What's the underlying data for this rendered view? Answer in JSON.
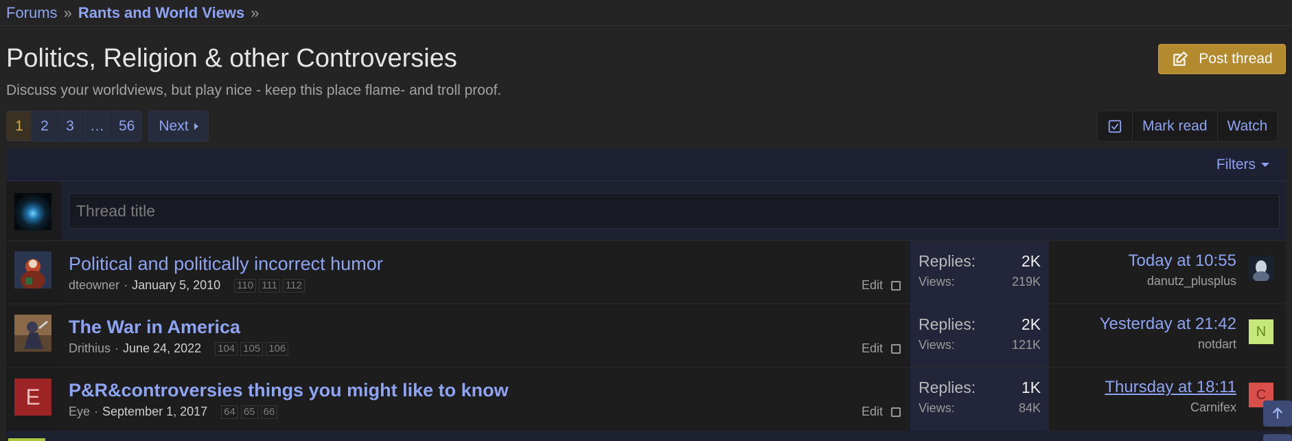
{
  "breadcrumb": {
    "items": [
      "Forums",
      "Rants and World Views"
    ]
  },
  "page": {
    "title": "Politics, Religion & other Controversies",
    "description": "Discuss your worldviews, but play nice - keep this place flame- and troll proof.",
    "post_thread_label": "Post thread"
  },
  "pagination": {
    "pages": [
      "1",
      "2",
      "3",
      "…",
      "56"
    ],
    "next_label": "Next"
  },
  "actions": {
    "mark_read_label": "Mark read",
    "watch_label": "Watch"
  },
  "filters": {
    "label": "Filters"
  },
  "quick_thread": {
    "placeholder": "Thread title"
  },
  "threads": [
    {
      "title": "Political and politically incorrect humor",
      "author": "dteowner",
      "date": "January 5, 2010",
      "pages": [
        "110",
        "111",
        "112"
      ],
      "edit_label": "Edit",
      "replies_label": "Replies:",
      "replies": "2K",
      "views_label": "Views:",
      "views": "219K",
      "last_date": "Today at 10:55",
      "last_user": "danutz_plusplus"
    },
    {
      "title": "The War in America",
      "author": "Drithius",
      "date": "June 24, 2022",
      "pages": [
        "104",
        "105",
        "106"
      ],
      "edit_label": "Edit",
      "replies_label": "Replies:",
      "replies": "2K",
      "views_label": "Views:",
      "views": "121K",
      "last_date": "Yesterday at 21:42",
      "last_user": "notdart",
      "last_avatar_letter": "N"
    },
    {
      "title": "P&R&controversies things you might like to know",
      "author": "Eye",
      "avatar_letter": "E",
      "date": "September 1, 2017",
      "pages": [
        "64",
        "65",
        "66"
      ],
      "edit_label": "Edit",
      "replies_label": "Replies:",
      "replies": "1K",
      "views_label": "Views:",
      "views": "84K",
      "last_date": "Thursday at 18:11",
      "last_user": "Carnifex",
      "last_avatar_letter": "C"
    }
  ],
  "colors": {
    "link": "#8ea4f2",
    "post_button": "#b38a2e",
    "active_page": "#d4aa4a",
    "avatar_e": "#9c2424",
    "avatar_n": "#c6e87a",
    "avatar_c": "#d9504a"
  },
  "icons": [
    "edit-icon",
    "check-square-icon",
    "caret-right-icon",
    "caret-down-icon",
    "arrow-up-icon"
  ]
}
